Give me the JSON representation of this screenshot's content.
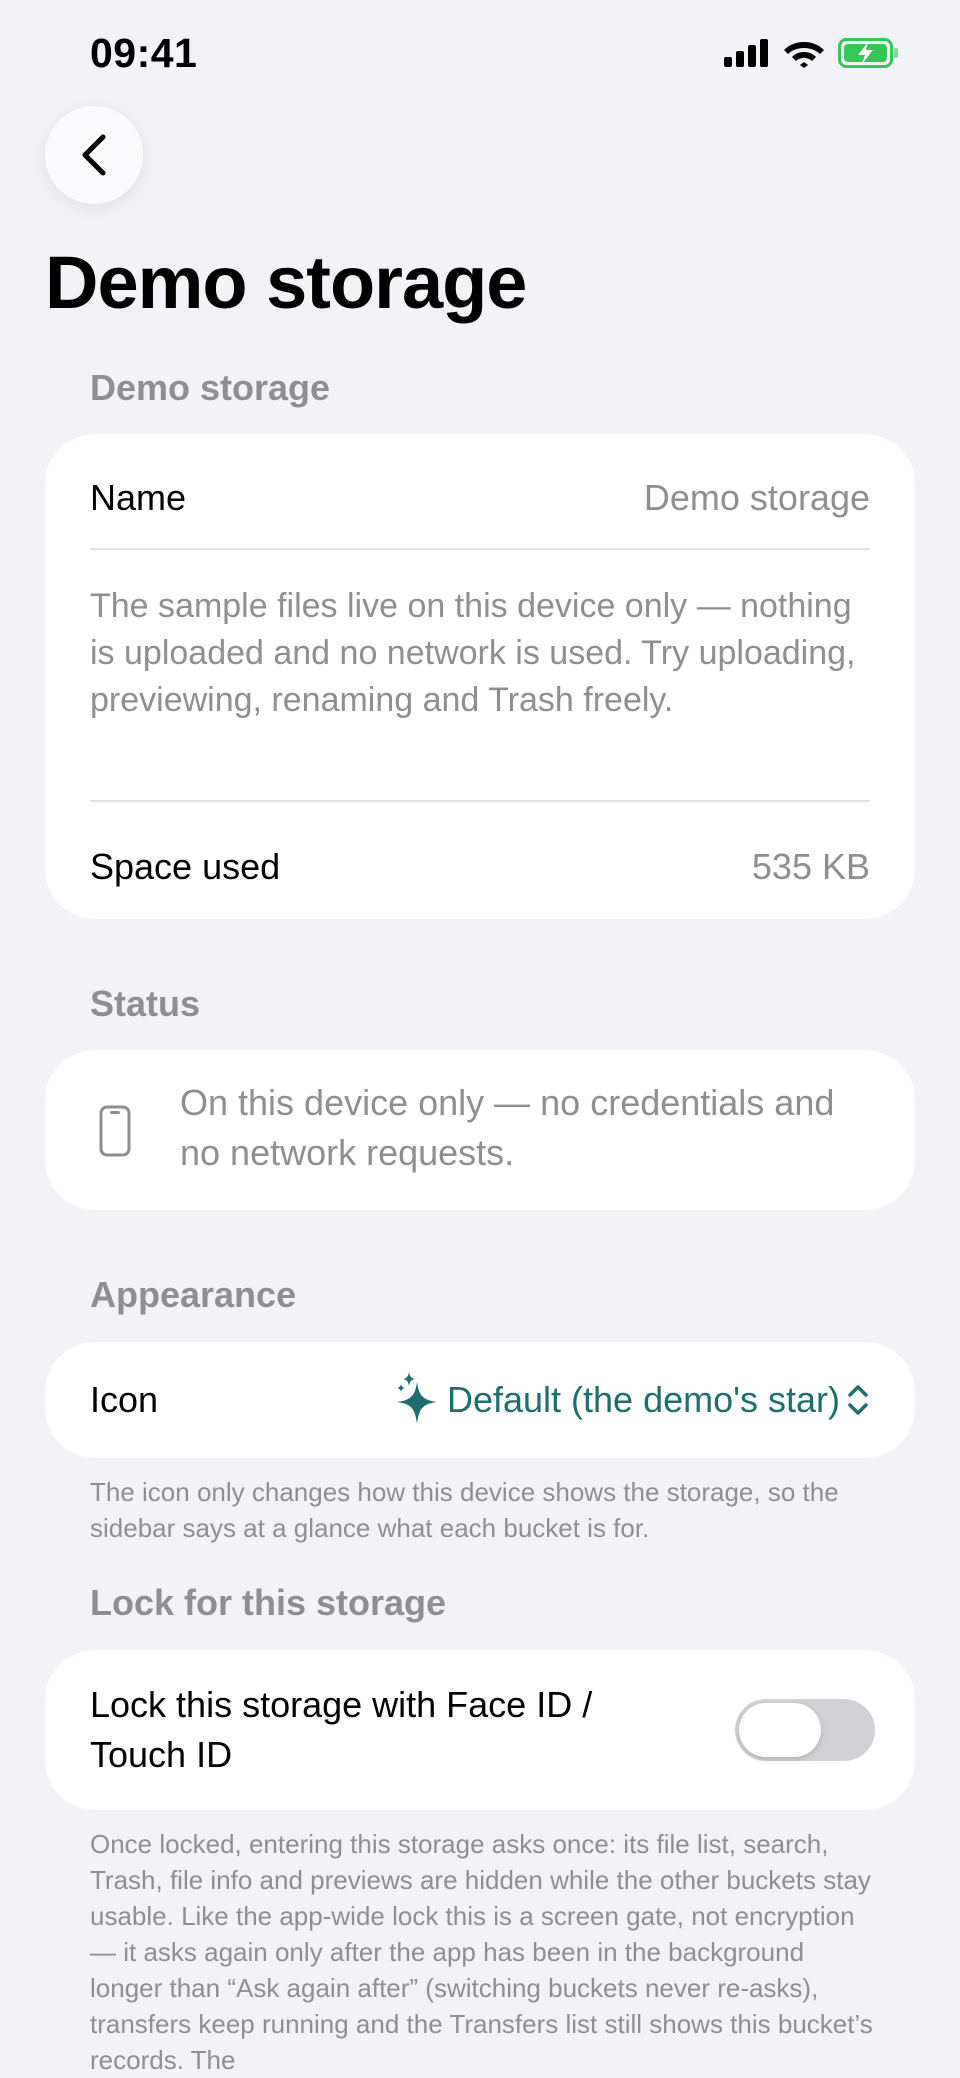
{
  "status_bar": {
    "time": "09:41",
    "icons": [
      "signal-icon",
      "wifi-icon",
      "battery-charging-icon"
    ],
    "battery_color": "#34c759"
  },
  "header": {
    "back_icon": "chevron-left-icon",
    "title": "Demo storage"
  },
  "section_storage": {
    "header": "Demo storage",
    "name_label": "Name",
    "name_value": "Demo storage",
    "description": "The sample files live on this device only — nothing is uploaded and no network is used. Try uploading, previewing, renaming and Trash freely.",
    "space_label": "Space used",
    "space_value": "535 KB"
  },
  "section_status": {
    "header": "Status",
    "icon": "phone-icon",
    "text": "On this device only — no credentials and no network requests."
  },
  "section_appearance": {
    "header": "Appearance",
    "icon_label": "Icon",
    "icon_value": "Default (the demo's star)",
    "accent_color": "#1d6f6b",
    "footnote": "The icon only changes how this device shows the storage, so the sidebar says at a glance what each bucket is for."
  },
  "section_lock": {
    "header": "Lock for this storage",
    "toggle_label": "Lock this storage with Face ID / Touch ID",
    "toggle_on": false,
    "footnote": "Once locked, entering this storage asks once: its file list, search, Trash, file info and previews are hidden while the other buckets stay usable. Like the app-wide lock this is a screen gate, not encryption — it asks again only after the app has been in the background longer than “Ask again after” (switching buckets never re-asks), transfers keep running and the Transfers list still shows this bucket’s records. The"
  }
}
